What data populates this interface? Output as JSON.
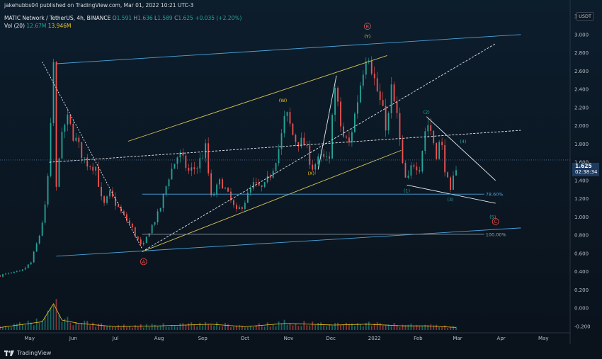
{
  "header": {
    "published_by": "jakehubbs04 published on TradingView.com, Mar 01, 2022 10:21 UTC-3",
    "symbol": "MATIC Network / TetherUS, 4h, BINANCE",
    "ohlc": {
      "o_label": "O",
      "o": "1.591",
      "h_label": "H",
      "h": "1.636",
      "l_label": "L",
      "l": "1.589",
      "c_label": "C",
      "c": "1.625",
      "change": "+0.035 (+2.20%)"
    },
    "vol_label": "Vol (20)",
    "vol_value": "12.67M",
    "vol_ma": "13.946M"
  },
  "footer": {
    "brand": "TradingView"
  },
  "currency": {
    "line1": "USDT"
  },
  "last_price": {
    "value": "1.625",
    "countdown": "02:38:34"
  },
  "colors": {
    "background": "#0b1622",
    "up": "#26a69a",
    "down": "#ef5350",
    "channel": "#d6c25a",
    "trendline": "#4aa3d9",
    "fib": "#4aa3d9",
    "white_line": "#e6e9ee",
    "label_yellow": "#f0c419",
    "label_green": "#26a69a",
    "label_red": "#ef5350"
  },
  "chart_data": {
    "type": "candlestick",
    "title": "MATIC Network / TetherUS, 4h, BINANCE",
    "x_ticks": [
      "May",
      "Jun",
      "Jul",
      "Aug",
      "Sep",
      "Oct",
      "Nov",
      "Dec",
      "2022",
      "Feb",
      "Mar",
      "Apr",
      "May"
    ],
    "x_tick_dates": [
      "2021-05-01",
      "2021-06-01",
      "2021-07-01",
      "2021-08-01",
      "2021-09-01",
      "2021-10-01",
      "2021-11-01",
      "2021-12-01",
      "2022-01-01",
      "2022-02-01",
      "2022-03-01",
      "2022-04-01",
      "2022-05-01"
    ],
    "xlim": [
      "2021-04-10",
      "2022-05-20"
    ],
    "y_ticks": [
      "3.200",
      "3.000",
      "2.800",
      "2.600",
      "2.400",
      "2.200",
      "2.000",
      "1.800",
      "1.600",
      "1.400",
      "1.200",
      "1.000",
      "0.800",
      "0.600",
      "0.400",
      "0.200",
      "0.000",
      "-0.200"
    ],
    "ylim": [
      -0.27,
      3.27
    ],
    "ylabel": "USDT",
    "price_path": [
      {
        "date": "2021-04-10",
        "price": 0.36
      },
      {
        "date": "2021-04-25",
        "price": 0.4
      },
      {
        "date": "2021-05-02",
        "price": 0.5
      },
      {
        "date": "2021-05-08",
        "price": 0.8
      },
      {
        "date": "2021-05-12",
        "price": 1.1
      },
      {
        "date": "2021-05-15",
        "price": 1.6
      },
      {
        "date": "2021-05-18",
        "price": 2.68
      },
      {
        "date": "2021-05-19",
        "price": 1.1
      },
      {
        "date": "2021-05-22",
        "price": 1.7
      },
      {
        "date": "2021-05-27",
        "price": 2.1
      },
      {
        "date": "2021-06-01",
        "price": 1.9
      },
      {
        "date": "2021-06-10",
        "price": 1.6
      },
      {
        "date": "2021-06-17",
        "price": 1.55
      },
      {
        "date": "2021-06-22",
        "price": 1.1
      },
      {
        "date": "2021-06-27",
        "price": 1.25
      },
      {
        "date": "2021-07-05",
        "price": 1.05
      },
      {
        "date": "2021-07-12",
        "price": 0.9
      },
      {
        "date": "2021-07-20",
        "price": 0.65
      },
      {
        "date": "2021-07-25",
        "price": 0.85
      },
      {
        "date": "2021-08-01",
        "price": 1.05
      },
      {
        "date": "2021-08-08",
        "price": 1.45
      },
      {
        "date": "2021-08-15",
        "price": 1.7
      },
      {
        "date": "2021-08-22",
        "price": 1.5
      },
      {
        "date": "2021-08-28",
        "price": 1.55
      },
      {
        "date": "2021-09-03",
        "price": 1.75
      },
      {
        "date": "2021-09-07",
        "price": 1.2
      },
      {
        "date": "2021-09-14",
        "price": 1.4
      },
      {
        "date": "2021-09-20",
        "price": 1.2
      },
      {
        "date": "2021-09-25",
        "price": 1.05
      },
      {
        "date": "2021-09-30",
        "price": 1.15
      },
      {
        "date": "2021-10-07",
        "price": 1.35
      },
      {
        "date": "2021-10-14",
        "price": 1.3
      },
      {
        "date": "2021-10-20",
        "price": 1.5
      },
      {
        "date": "2021-10-26",
        "price": 1.8
      },
      {
        "date": "2021-10-30",
        "price": 2.15
      },
      {
        "date": "2021-11-05",
        "price": 1.85
      },
      {
        "date": "2021-11-12",
        "price": 1.8
      },
      {
        "date": "2021-11-18",
        "price": 1.55
      },
      {
        "date": "2021-11-24",
        "price": 1.65
      },
      {
        "date": "2021-11-30",
        "price": 1.6
      },
      {
        "date": "2021-12-03",
        "price": 2.5
      },
      {
        "date": "2021-12-05",
        "price": 2.3
      },
      {
        "date": "2021-12-09",
        "price": 1.9
      },
      {
        "date": "2021-12-14",
        "price": 1.8
      },
      {
        "date": "2021-12-19",
        "price": 2.2
      },
      {
        "date": "2021-12-23",
        "price": 2.55
      },
      {
        "date": "2021-12-27",
        "price": 2.88
      },
      {
        "date": "2022-01-01",
        "price": 2.5
      },
      {
        "date": "2022-01-06",
        "price": 2.2
      },
      {
        "date": "2022-01-10",
        "price": 1.95
      },
      {
        "date": "2022-01-13",
        "price": 2.4
      },
      {
        "date": "2022-01-17",
        "price": 2.1
      },
      {
        "date": "2022-01-21",
        "price": 1.55
      },
      {
        "date": "2022-01-24",
        "price": 1.35
      },
      {
        "date": "2022-01-28",
        "price": 1.6
      },
      {
        "date": "2022-02-02",
        "price": 1.55
      },
      {
        "date": "2022-02-07",
        "price": 2.05
      },
      {
        "date": "2022-02-10",
        "price": 1.95
      },
      {
        "date": "2022-02-14",
        "price": 1.7
      },
      {
        "date": "2022-02-17",
        "price": 1.85
      },
      {
        "date": "2022-02-21",
        "price": 1.45
      },
      {
        "date": "2022-02-24",
        "price": 1.25
      },
      {
        "date": "2022-02-27",
        "price": 1.5
      },
      {
        "date": "2022-03-01",
        "price": 1.625
      }
    ],
    "volume_path": [
      {
        "date": "2021-04-10",
        "v": 0.03
      },
      {
        "date": "2021-05-10",
        "v": 0.1
      },
      {
        "date": "2021-05-18",
        "v": 0.32
      },
      {
        "date": "2021-05-24",
        "v": 0.12
      },
      {
        "date": "2021-06-05",
        "v": 0.08
      },
      {
        "date": "2021-07-01",
        "v": 0.04
      },
      {
        "date": "2021-08-01",
        "v": 0.05
      },
      {
        "date": "2021-09-07",
        "v": 0.07
      },
      {
        "date": "2021-10-01",
        "v": 0.04
      },
      {
        "date": "2021-10-30",
        "v": 0.08
      },
      {
        "date": "2021-12-03",
        "v": 0.06
      },
      {
        "date": "2021-12-27",
        "v": 0.07
      },
      {
        "date": "2022-01-21",
        "v": 0.05
      },
      {
        "date": "2022-02-07",
        "v": 0.05
      },
      {
        "date": "2022-03-01",
        "v": 0.03
      }
    ],
    "annotations": [
      {
        "text": "(W)",
        "date": "2021-10-28",
        "price": 2.28,
        "color": "yellow"
      },
      {
        "text": "(X)",
        "date": "2021-11-17",
        "price": 1.48,
        "color": "yellow"
      },
      {
        "text": "(Y)",
        "date": "2021-12-27",
        "price": 2.98,
        "color": "yellow"
      },
      {
        "text": "B",
        "date": "2021-12-27",
        "price": 3.09,
        "color": "red",
        "circled": true
      },
      {
        "text": "A",
        "date": "2021-07-21",
        "price": 0.51,
        "color": "red",
        "circled": true
      },
      {
        "text": "(1)",
        "date": "2022-01-24",
        "price": 1.29,
        "color": "green"
      },
      {
        "text": "(2)",
        "date": "2022-02-07",
        "price": 2.15,
        "color": "green"
      },
      {
        "text": "(3)",
        "date": "2022-02-24",
        "price": 1.19,
        "color": "green"
      },
      {
        "text": "(4)",
        "date": "2022-03-05",
        "price": 1.83,
        "color": "green"
      },
      {
        "text": "(5)",
        "date": "2022-03-26",
        "price": 1.0,
        "color": "green"
      },
      {
        "text": "C",
        "date": "2022-03-28",
        "price": 0.95,
        "color": "red",
        "circled": true
      }
    ],
    "fib_levels": [
      {
        "label": "78.60%",
        "price": 1.25
      },
      {
        "label": "100.00%",
        "price": 0.81
      }
    ],
    "grid": false,
    "legend": "none"
  }
}
